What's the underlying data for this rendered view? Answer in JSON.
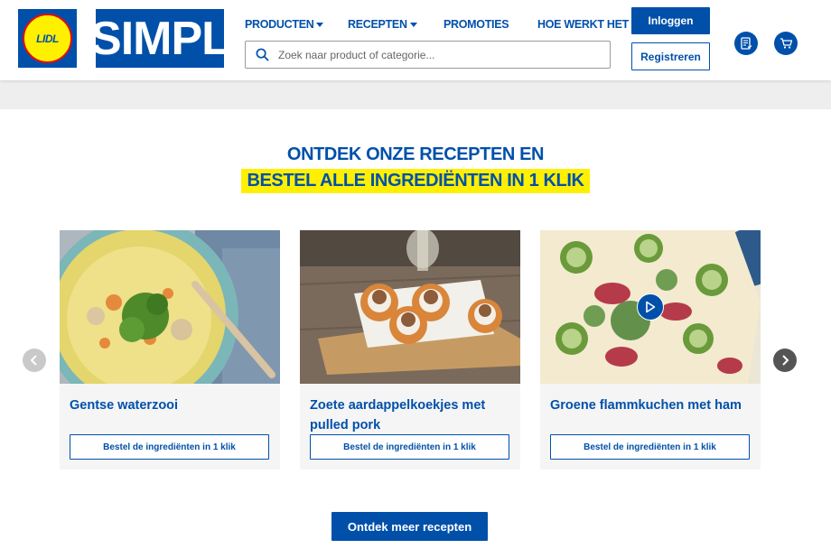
{
  "header": {
    "lidl_logo_text": "LIDL",
    "simpl_logo_text": "SIMPL",
    "nav": [
      {
        "label": "PRODUCTEN",
        "dropdown": true
      },
      {
        "label": "RECEPTEN",
        "dropdown": true
      },
      {
        "label": "PROMOTIES",
        "dropdown": false
      },
      {
        "label": "HOE WERKT HET",
        "dropdown": false
      }
    ],
    "search_placeholder": "Zoek naar product of categorie...",
    "login_label": "Inloggen",
    "register_label": "Registreren",
    "icons": [
      "shopping-list-icon",
      "cart-icon"
    ]
  },
  "hero": {
    "line1": "ONTDEK ONZE RECEPTEN EN",
    "line2": "BESTEL ALLE INGREDIËNTEN IN 1 KLIK"
  },
  "recipes": [
    {
      "title": "Gentse waterzooi",
      "button": "Bestel de ingrediënten in 1 klik"
    },
    {
      "title": "Zoete aardappelkoekjes met pulled pork",
      "button": "Bestel de ingrediënten in 1 klik"
    },
    {
      "title": "Groene flammkuchen met ham",
      "button": "Bestel de ingrediënten in 1 klik",
      "has_video": true
    }
  ],
  "more_button": "Ontdek meer recepten",
  "colors": {
    "brand_blue": "#0050aa",
    "highlight_yellow": "#fff000",
    "lidl_red": "#e60a14"
  }
}
